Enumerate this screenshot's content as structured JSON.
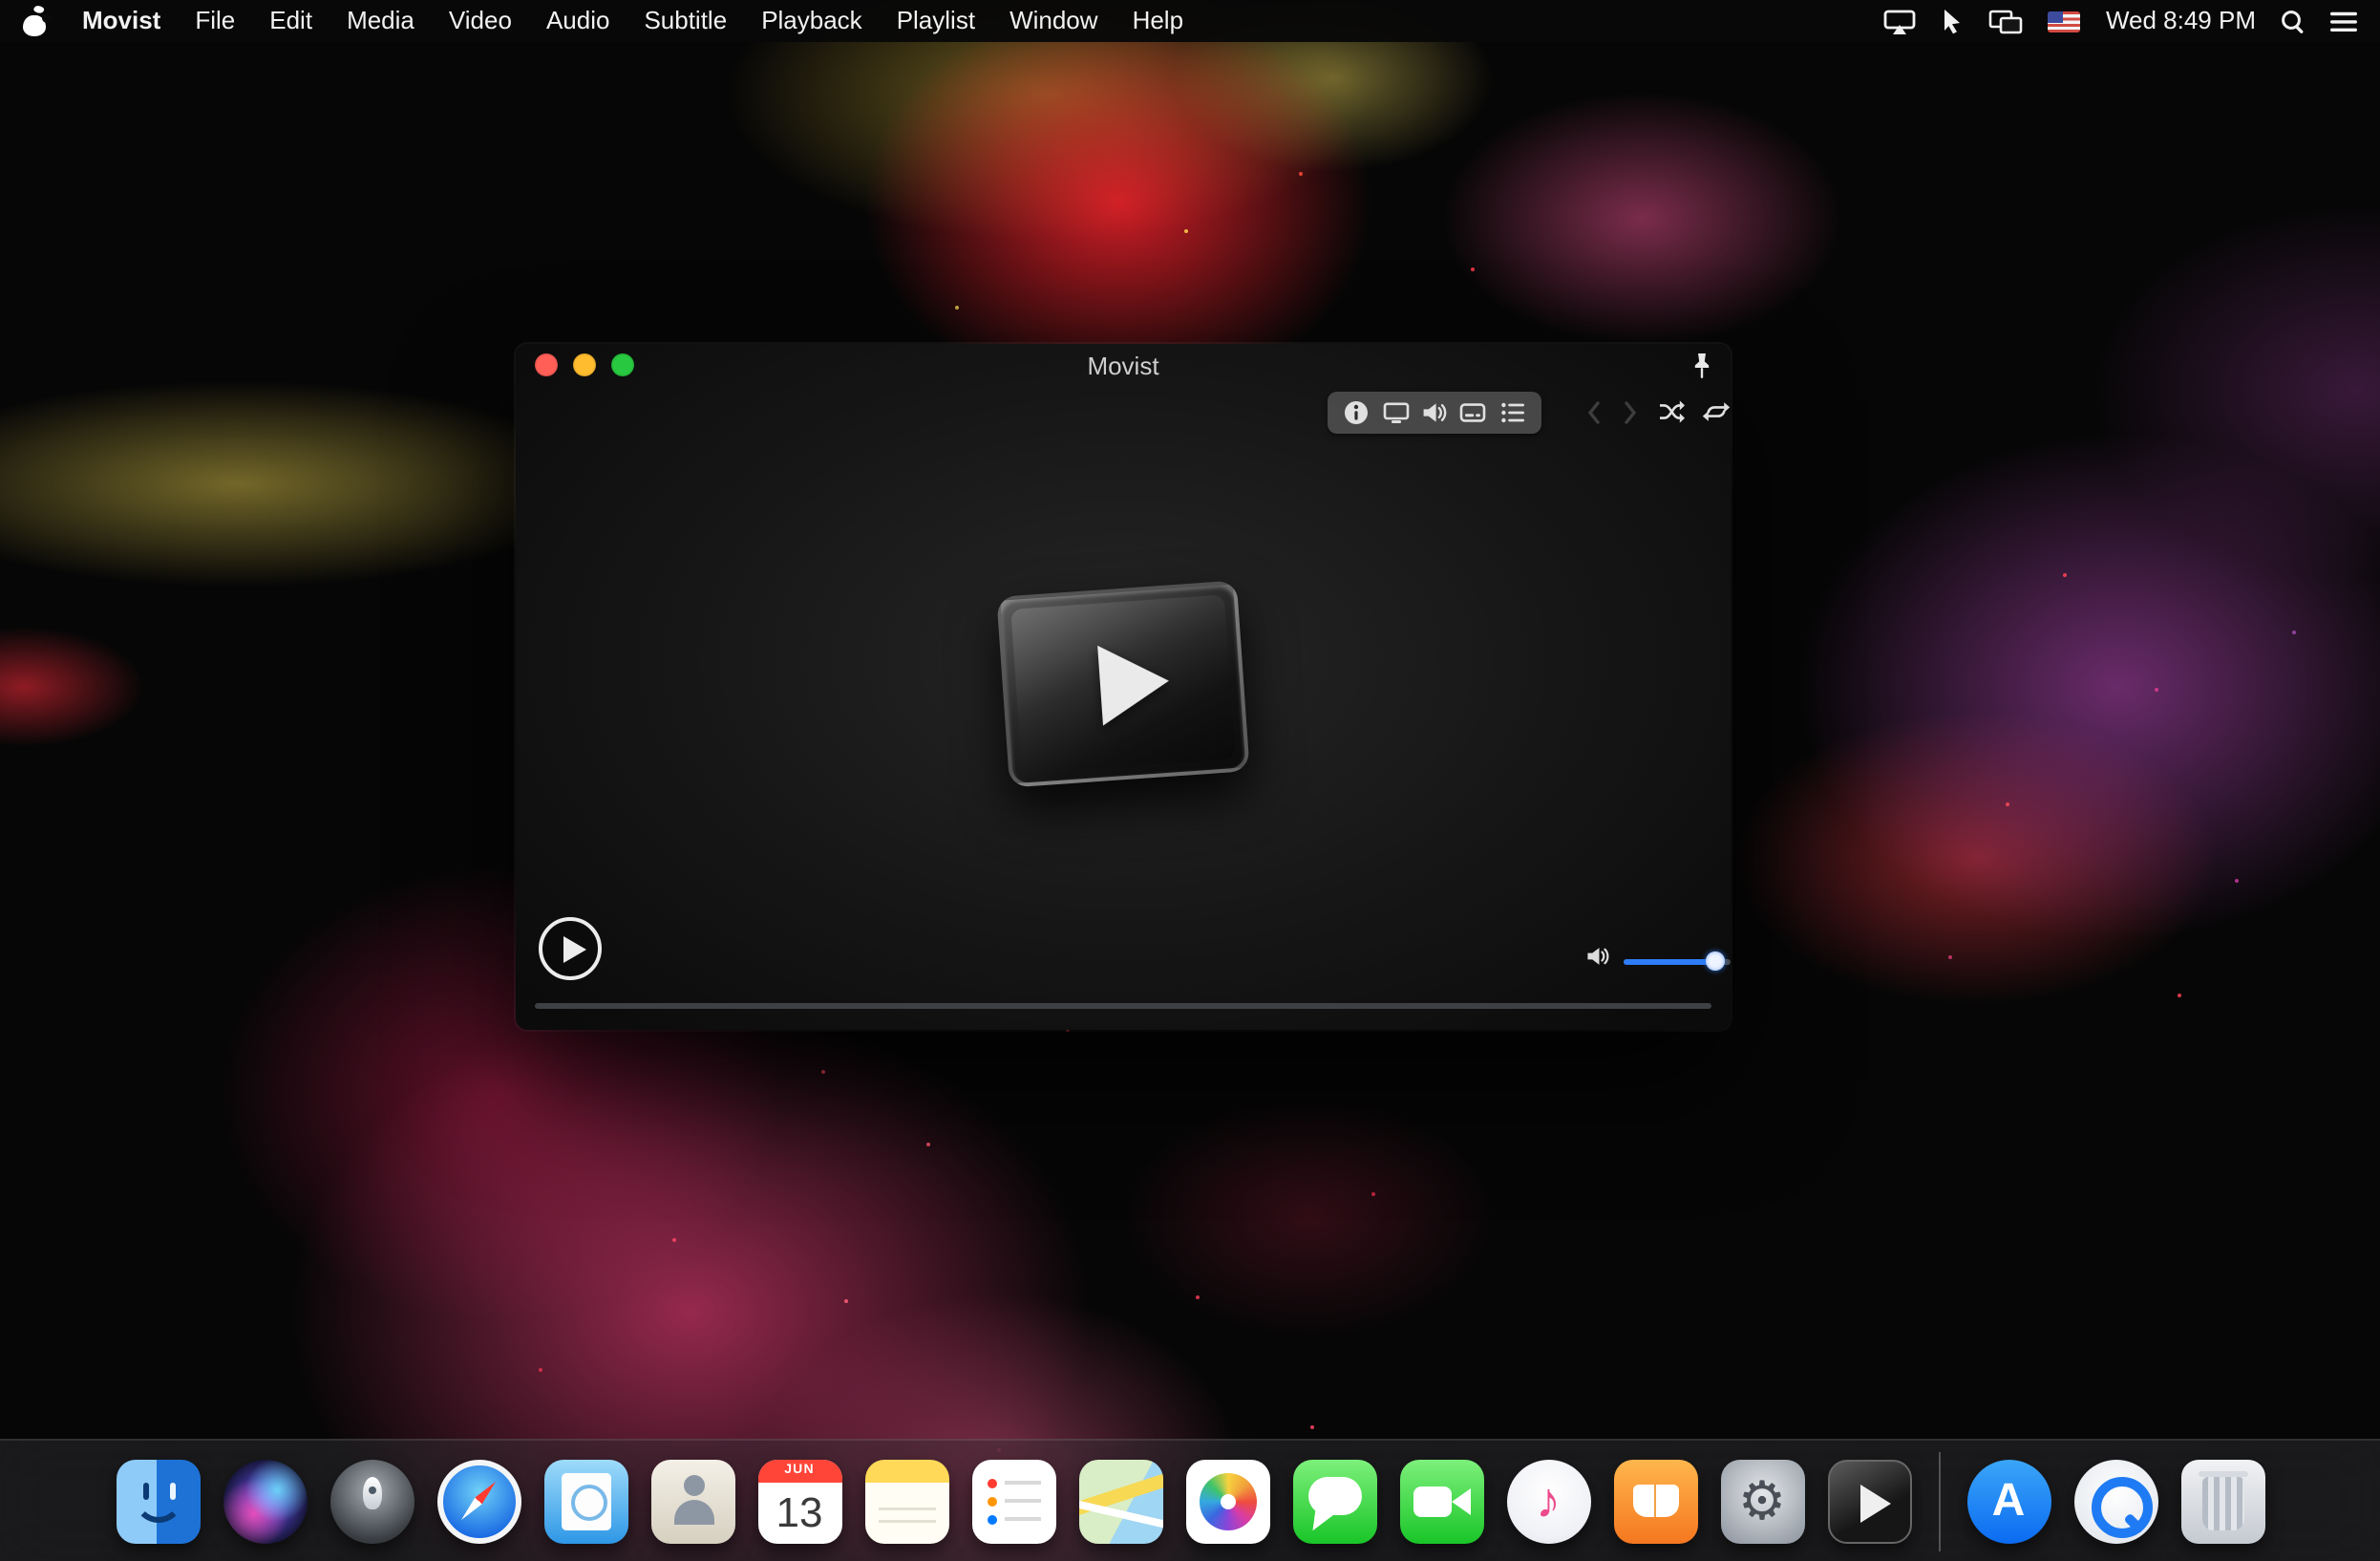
{
  "menu_bar": {
    "items": [
      "Movist",
      "File",
      "Edit",
      "Media",
      "Video",
      "Audio",
      "Subtitle",
      "Playback",
      "Playlist",
      "Window",
      "Help"
    ],
    "time": "Wed 8:49 PM",
    "status_icons": [
      "airplay-icon",
      "pointer-icon",
      "screen-mirroring-icon",
      "us-flag-icon",
      "spotlight-icon",
      "notification-center-icon"
    ]
  },
  "window": {
    "title": "Movist",
    "traffic_lights": [
      "close",
      "minimize",
      "zoom"
    ],
    "hud_icons": [
      "info-icon",
      "display-icon",
      "volume-icon",
      "subtitle-icon",
      "playlist-icon"
    ],
    "transport_icons": [
      "previous-icon",
      "next-icon",
      "shuffle-icon",
      "repeat-icon"
    ],
    "pin_icon": "pin-icon",
    "center_icon": "movist-play-logo",
    "play_button": "play-icon",
    "volume": {
      "level_percent": 86,
      "accent_color": "#2e7cf6"
    },
    "progress_percent": 0
  },
  "dock": {
    "items": [
      "finder",
      "siri",
      "launchpad",
      "safari",
      "mail",
      "contacts",
      "calendar",
      "notes",
      "reminders",
      "maps",
      "photos",
      "messages",
      "facetime",
      "itunes",
      "ibooks",
      "system-preferences",
      "movist",
      "app-store",
      "quicktime",
      "trash"
    ],
    "calendar": {
      "month": "JUN",
      "day": "13"
    }
  },
  "colors": {
    "accent_blue": "#2e7cf6",
    "traffic_red": "#ff5f57",
    "traffic_yellow": "#febc2e",
    "traffic_green": "#28c840",
    "menu_bar_bg": "#080808"
  }
}
